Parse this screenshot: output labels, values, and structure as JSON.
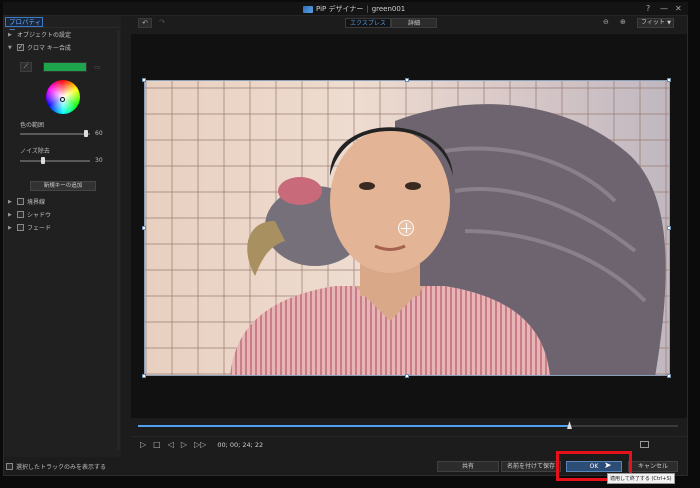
{
  "window": {
    "app_title": "PiP デザイナー",
    "separator": "|",
    "document_name": "green001",
    "help_label": "?",
    "minimize_label": "—",
    "close_label": "✕"
  },
  "left_panel": {
    "tab_label": "プロパティー",
    "sections": {
      "object_settings": "オブジェクトの設定",
      "chroma_key": "クロマ キー合成",
      "border": "境界線",
      "shadow": "シャドウ",
      "fade": "フェード"
    },
    "chroma": {
      "key_color": "#1ea44a",
      "color_range_label": "色の範囲",
      "color_range_value": "60",
      "noise_label": "ノイズ除去",
      "noise_value": "30",
      "add_key_label": "新規キーの追加"
    },
    "show_selected_track_label": "選択したトラックのみを表示する"
  },
  "toolbar": {
    "undo_icon": "↶",
    "redo_icon": "↷",
    "mode_express": "エクスプレス",
    "mode_advanced": "詳細",
    "zoom_out_icon": "⊖",
    "zoom_in_icon": "⊕",
    "fit_label": "フィット"
  },
  "player": {
    "timecode": "00; 00; 24; 22",
    "progress": 0.8
  },
  "buttons": {
    "share": "共有",
    "save_as": "名前を付けて保存",
    "ok": "OK",
    "cancel": "キャンセル"
  },
  "tooltip": "適用して終了する (Ctrl+S)",
  "colors": {
    "accent": "#4fa0ef",
    "highlight": "#e8101b"
  }
}
